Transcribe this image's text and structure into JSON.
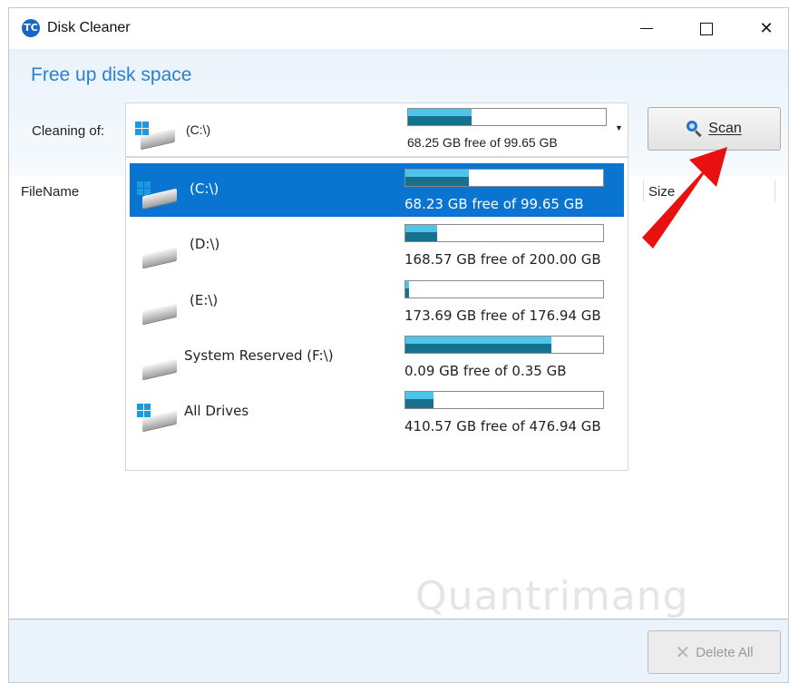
{
  "window": {
    "title": "Disk Cleaner"
  },
  "header": {
    "heading": "Free up disk space",
    "cleaning_label": "Cleaning of:"
  },
  "combo": {
    "selected_name": "(C:\\)",
    "selected_free": "68.25 GB free of 99.65 GB",
    "selected_used_fraction": 0.32
  },
  "scan_button": {
    "label": "Scan"
  },
  "list_header": {
    "filename": "FileName",
    "size": "Size"
  },
  "drives": [
    {
      "name": "(C:\\)",
      "free": "68.23 GB free of 99.65 GB",
      "used_fraction": 0.32,
      "icon": "windows-drive-icon",
      "selected": true
    },
    {
      "name": "(D:\\)",
      "free": "168.57 GB free of 200.00 GB",
      "used_fraction": 0.16,
      "icon": "drive-icon",
      "selected": false
    },
    {
      "name": "(E:\\)",
      "free": "173.69 GB free of 176.94 GB",
      "used_fraction": 0.02,
      "icon": "drive-icon",
      "selected": false
    },
    {
      "name": "System Reserved (F:\\)",
      "free": "0.09 GB free of 0.35 GB",
      "used_fraction": 0.74,
      "icon": "drive-icon",
      "selected": false
    },
    {
      "name": "All Drives",
      "free": "410.57 GB free of 476.94 GB",
      "used_fraction": 0.14,
      "icon": "windows-drive-icon",
      "selected": false
    }
  ],
  "delete_button": {
    "label": "Delete All"
  },
  "watermark": "Quantrimang",
  "colors": {
    "accent": "#2a7fd1",
    "selection": "#0a74d1",
    "arrow": "#e8110f"
  }
}
